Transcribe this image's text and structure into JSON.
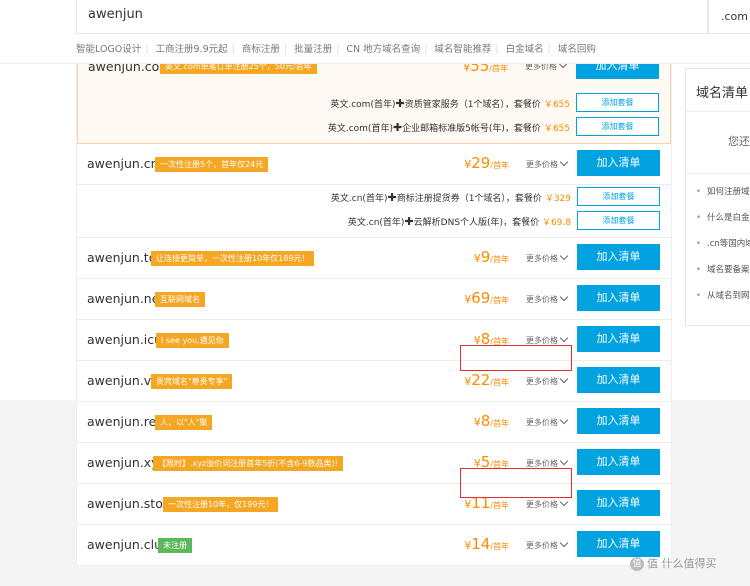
{
  "search": {
    "value": "awenjun",
    "suffix": ".com"
  },
  "links": [
    "智能LOGO设计",
    "工商注册9.9元起",
    "商标注册",
    "批量注册",
    "CN 地方域名查询",
    "域名智能推荐",
    "白金域名",
    "域名回购"
  ],
  "common": {
    "per_year": "/首年",
    "more": "更多价格",
    "add": "加入清单",
    "pkg_add": "添加套餐"
  },
  "rows": [
    {
      "name": "awenjun.com",
      "tag": "英文.com单笔订单注册25个，50元/首年",
      "price": "55",
      "packages": [
        {
          "a": "英文.com(首年)",
          "b": "资质管家服务（1个域名）",
          "c": "，套餐价",
          "p": "￥655"
        },
        {
          "a": "英文.com(首年)",
          "b": "企业邮箱标准版5帐号(年)",
          "c": "，套餐价",
          "p": "￥655"
        }
      ]
    },
    {
      "name": "awenjun.cn",
      "tag": "一次性注册5个，首年仅24元",
      "price": "29",
      "packages": [
        {
          "a": "英文.cn(首年)",
          "b": "商标注册提货券（1个域名）",
          "c": "，套餐价",
          "p": "￥329"
        },
        {
          "a": "英文.cn(首年)",
          "b": "云解析DNS个人版(年)",
          "c": "，套餐价",
          "p": "￥69.8"
        }
      ]
    },
    {
      "name": "awenjun.top",
      "tag": "让连接更简单，一次性注册10年仅189元！",
      "price": "9"
    },
    {
      "name": "awenjun.net",
      "tag": "互联网域名",
      "price": "69"
    },
    {
      "name": "awenjun.icu",
      "tag": "I see you,遇见你",
      "price": "8"
    },
    {
      "name": "awenjun.vip",
      "tag": "贵宾域名\"尊贵专享\"",
      "price": "22"
    },
    {
      "name": "awenjun.ren",
      "tag": "人，以\"人\"聚",
      "price": "8"
    },
    {
      "name": "awenjun.xyz",
      "tag": "【限时】.xyz溢价词注册首年5折(不含6-9数品类)!",
      "price": "5"
    },
    {
      "name": "awenjun.store",
      "tag": "一次性注册10年，仅199元！",
      "price": "11"
    },
    {
      "name": "awenjun.club",
      "tag": "未注册",
      "price": "14"
    }
  ],
  "sidebar": {
    "title": "域名清单",
    "empty": "您还",
    "faqs": [
      "如何注册域",
      "什么是白金",
      ".cn等国内域",
      "域名要备案",
      "从域名到网"
    ]
  },
  "watermark": "值 什么值得买",
  "colors": {
    "accent": "#00a2e0",
    "price": "#ff8a00",
    "tag": "#f5a623",
    "tag_green": "#5bb85b"
  }
}
